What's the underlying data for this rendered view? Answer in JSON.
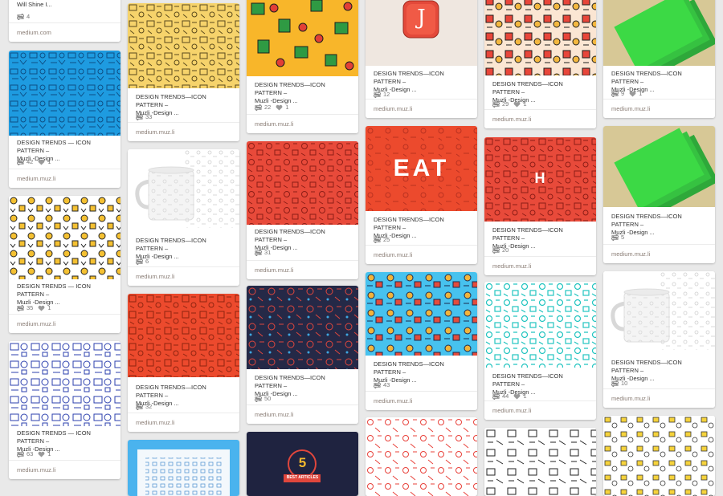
{
  "feed": {
    "top_card": {
      "desc": "Will Shine I...",
      "repins": "4",
      "source": "medium.com"
    },
    "pin_desc_line1": "DESIGN TRENDS — ICON PATTERN –",
    "pin_desc_line2": "Muzli -Design ...",
    "mug_desc_line1": "DESIGN TRENDS—ICON PATTERN –",
    "source": "medium.muz.li",
    "pins": [
      {
        "id": "c1p1",
        "repins": "42",
        "likes": "1"
      },
      {
        "id": "c1p2",
        "repins": "35",
        "likes": "1"
      },
      {
        "id": "c1p3",
        "repins": "63",
        "likes": "1"
      },
      {
        "id": "c2p1",
        "repins": "33"
      },
      {
        "id": "c2p2",
        "repins": "6"
      },
      {
        "id": "c2p3",
        "repins": "32"
      },
      {
        "id": "c3p1",
        "repins": "22",
        "likes": "1"
      },
      {
        "id": "c3p2",
        "repins": "31"
      },
      {
        "id": "c3p3",
        "repins": "50"
      },
      {
        "id": "c4p1",
        "repins": "12"
      },
      {
        "id": "c4p2",
        "repins": "25",
        "image_text": "EAT"
      },
      {
        "id": "c4p3",
        "repins": "43"
      },
      {
        "id": "c5p1",
        "repins": "29",
        "likes": "1"
      },
      {
        "id": "c5p2",
        "repins": "20"
      },
      {
        "id": "c5p3",
        "repins": "44",
        "likes": "1"
      },
      {
        "id": "c6p1",
        "repins": "9",
        "likes": "1"
      },
      {
        "id": "c6p2",
        "repins": "5"
      },
      {
        "id": "c6p3",
        "repins": "10"
      }
    ],
    "bottom_badge_text": "BEST ARTICLES",
    "badge_number": "5",
    "tile_letter": "J",
    "colors": {
      "blue": "#1e9be0",
      "yellow": "#f6d36b",
      "orange_red": "#ec4a2d",
      "navy": "#252947",
      "green": "#3cd945",
      "teal": "#21c4c0",
      "red": "#e84a3a",
      "sky": "#47c2ee"
    }
  }
}
